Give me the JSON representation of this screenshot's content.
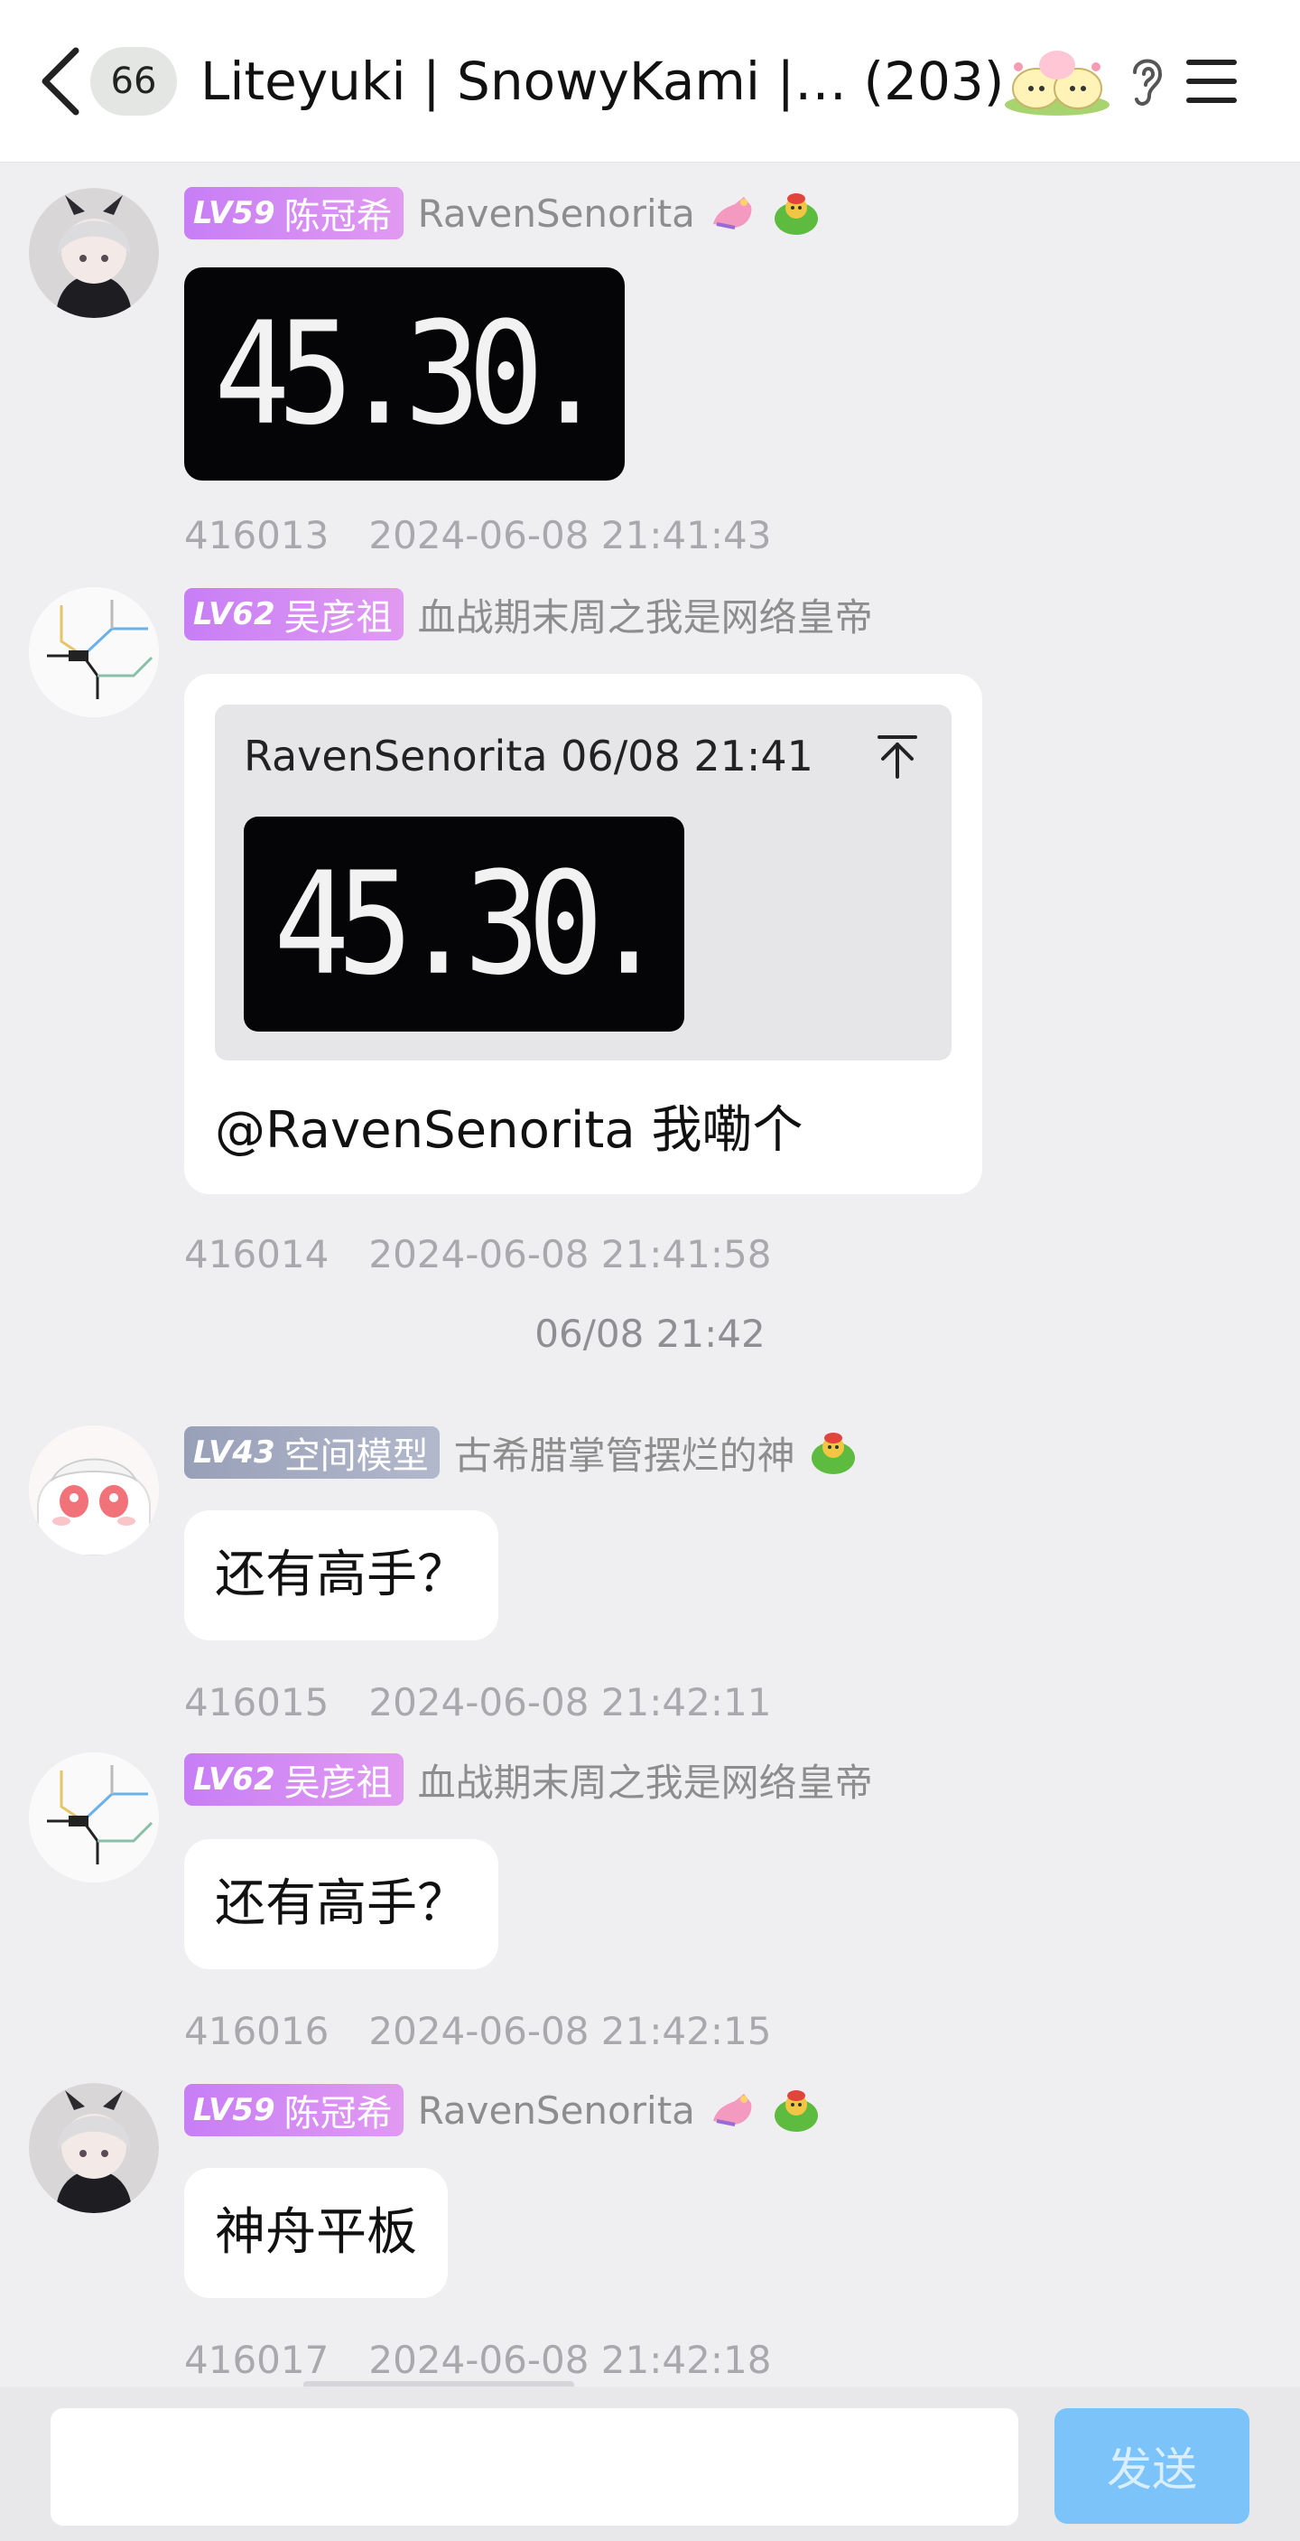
{
  "header": {
    "unread_count": "66",
    "group_title": "Liteyuki | SnowyKami |…  (203)"
  },
  "messages": [
    {
      "level": "LV59",
      "title": "陈冠希",
      "nickname": "RavenSenorita",
      "type": "image",
      "image_text": "45.30.",
      "msg_id": "416013",
      "timestamp": "2024-06-08 21:41:43"
    },
    {
      "level": "LV62",
      "title": "吴彦祖",
      "nickname": "血战期末周之我是网络皇帝",
      "type": "reply",
      "quote_header": "RavenSenorita 06/08 21:41",
      "quote_image_text": "45.30.",
      "text": "@RavenSenorita 我嘞个",
      "msg_id": "416014",
      "timestamp": "2024-06-08 21:41:58"
    },
    {
      "level": "LV43",
      "title": "空间模型",
      "nickname": "古希腊掌管摆烂的神",
      "type": "text",
      "text": "还有高手？",
      "msg_id": "416015",
      "timestamp": "2024-06-08 21:42:11"
    },
    {
      "level": "LV62",
      "title": "吴彦祖",
      "nickname": "血战期末周之我是网络皇帝",
      "type": "text",
      "text": "还有高手？",
      "msg_id": "416016",
      "timestamp": "2024-06-08 21:42:15"
    },
    {
      "level": "LV59",
      "title": "陈冠希",
      "nickname": "RavenSenorita",
      "type": "text",
      "text": "神舟平板",
      "msg_id": "416017",
      "timestamp": "2024-06-08 21:42:18"
    }
  ],
  "center_time": "06/08 21:42",
  "input": {
    "value": "",
    "send_label": "发送"
  },
  "colors": {
    "level_badge_purple": "#d08cf3",
    "level_badge_gray": "#a4abc2",
    "send_button": "#7cc3fa",
    "background": "#efeff1"
  }
}
